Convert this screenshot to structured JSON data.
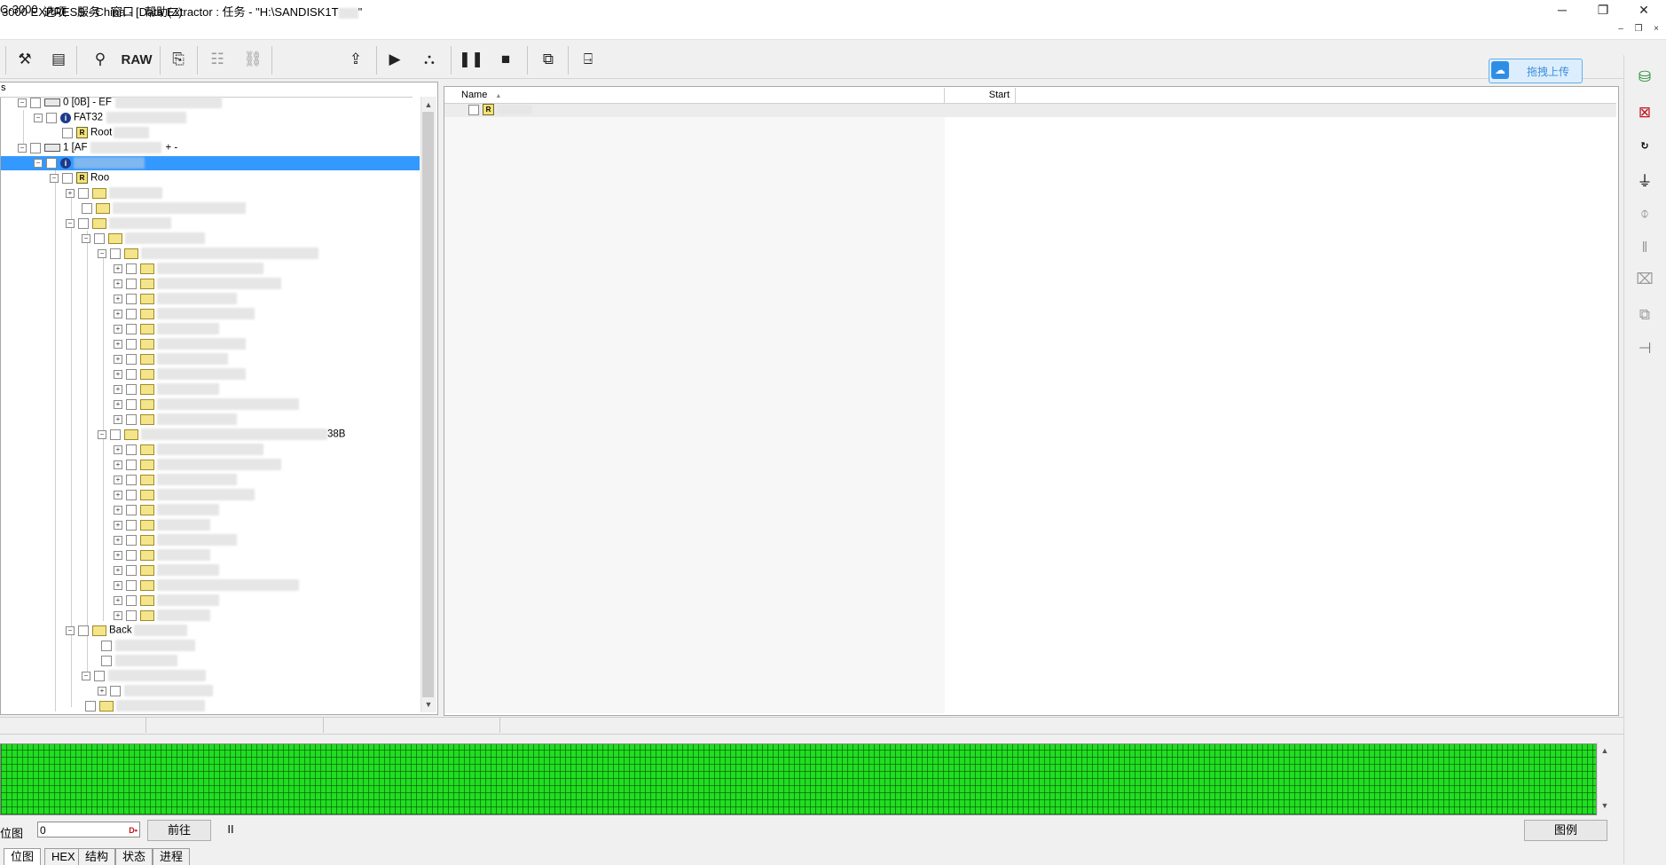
{
  "window": {
    "title": "3000 EXPRESS - China - [Data Extractor : 任务 - \"H:\\SANDISK1T",
    "title_suffix": "\"",
    "controls": [
      "─",
      "❐",
      "✕"
    ]
  },
  "menu": {
    "items": [
      "C-3000",
      "选项",
      "服务",
      "窗口",
      "帮助(Z)"
    ],
    "mdi_controls": [
      "–",
      "❐",
      "×"
    ]
  },
  "toolbar": {
    "raw_label": "RAW",
    "upload_label": "拖拽上传"
  },
  "tree": {
    "header": "s",
    "nodes": {
      "disk0": "0 [0B] - EF",
      "fat32": "FAT32",
      "root0": "Root",
      "disk1": "1 [AF",
      "disk1_suffix": "+ -",
      "root1": "Roo",
      "folder_38b_suffix": "38B",
      "back_folder": "Back"
    },
    "root_badge": "R",
    "info_badge": "i"
  },
  "list": {
    "columns": [
      "Name",
      "Start"
    ],
    "sort_indicator": "▲"
  },
  "bottom": {
    "bitmap_label": "位图",
    "position_value": "0",
    "goto_label": "前往",
    "pause_label": "II",
    "legend_label": "图例",
    "tabs": [
      "位图",
      "HEX",
      "结构",
      "状态",
      "进程"
    ]
  },
  "colors": {
    "selection": "#3399ff",
    "bitmap_used": "#22dd22",
    "upload_accent": "#2d8ee6"
  }
}
